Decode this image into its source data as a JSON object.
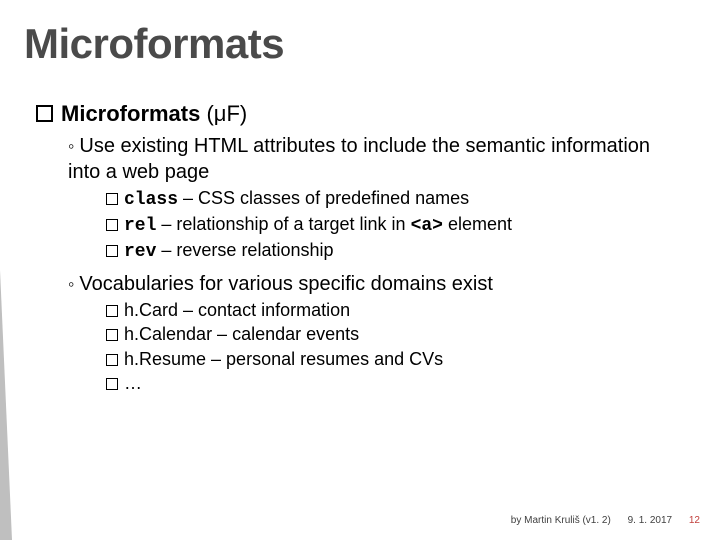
{
  "title": "Microformats",
  "heading_bold": "Microformats",
  "heading_rest": " (μF)",
  "sub1": "Use existing HTML attributes to include the semantic information into a web page",
  "s1a_code": "class",
  "s1a_rest": " – CSS classes of predefined names",
  "s1b_code": "rel",
  "s1b_rest_a": " – relationship of a target link in ",
  "s1b_code2": "<a>",
  "s1b_rest_b": " element",
  "s1c_code": "rev",
  "s1c_rest": " – reverse relationship",
  "sub2": "Vocabularies for various specific domains exist",
  "s2a": "h.Card – contact information",
  "s2b": "h.Calendar – calendar events",
  "s2c": "h.Resume – personal resumes and CVs",
  "s2d": "…",
  "footer_author": "by Martin Kruliš (v1. 2)",
  "footer_date": "9. 1. 2017",
  "page_number": "12"
}
